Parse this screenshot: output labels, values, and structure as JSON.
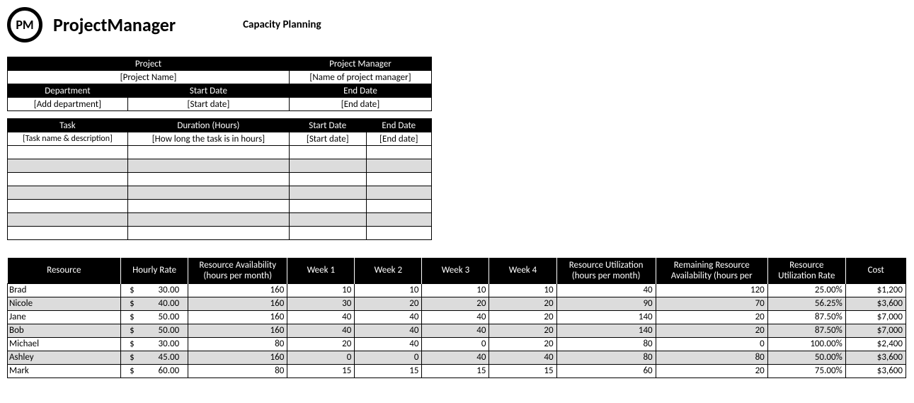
{
  "brand": "ProjectManager",
  "logo_abbrev": "PM",
  "page_title": "Capacity Planning",
  "info_headers": {
    "project": "Project",
    "project_manager": "Project Manager",
    "department": "Department",
    "start_date": "Start Date",
    "end_date": "End Date"
  },
  "info_values": {
    "project": "[Project Name]",
    "project_manager": "[Name of project manager]",
    "department": "[Add department]",
    "start_date": "[Start date]",
    "end_date": "[End date]"
  },
  "task_headers": {
    "task": "Task",
    "duration": "Duration (Hours)",
    "start": "Start Date",
    "end": "End Date"
  },
  "task_placeholders": {
    "task": "[Task name & description]",
    "duration": "[How long the task is in hours]",
    "start": "[Start date]",
    "end": "[End date]"
  },
  "resource_headers": {
    "resource": "Resource",
    "rate": "Hourly Rate",
    "avail": "Resource Availability (hours per month)",
    "w1": "Week 1",
    "w2": "Week 2",
    "w3": "Week 3",
    "w4": "Week 4",
    "util": "Resource Utilization (hours per month)",
    "remain": "Remaining Resource Availability (hours per",
    "util_rate": "Resource Utilization Rate",
    "cost": "Cost"
  },
  "resources": [
    {
      "name": "Brad",
      "rate": "30.00",
      "avail": "160",
      "w1": "10",
      "w2": "10",
      "w3": "10",
      "w4": "10",
      "util": "40",
      "remain": "120",
      "util_rate": "25.00%",
      "cost": "$1,200"
    },
    {
      "name": "Nicole",
      "rate": "40.00",
      "avail": "160",
      "w1": "30",
      "w2": "20",
      "w3": "20",
      "w4": "20",
      "util": "90",
      "remain": "70",
      "util_rate": "56.25%",
      "cost": "$3,600"
    },
    {
      "name": "Jane",
      "rate": "50.00",
      "avail": "160",
      "w1": "40",
      "w2": "40",
      "w3": "40",
      "w4": "20",
      "util": "140",
      "remain": "20",
      "util_rate": "87.50%",
      "cost": "$7,000"
    },
    {
      "name": "Bob",
      "rate": "50.00",
      "avail": "160",
      "w1": "40",
      "w2": "40",
      "w3": "40",
      "w4": "20",
      "util": "140",
      "remain": "20",
      "util_rate": "87.50%",
      "cost": "$7,000"
    },
    {
      "name": "Michael",
      "rate": "30.00",
      "avail": "80",
      "w1": "20",
      "w2": "40",
      "w3": "0",
      "w4": "20",
      "util": "80",
      "remain": "0",
      "util_rate": "100.00%",
      "cost": "$2,400"
    },
    {
      "name": "Ashley",
      "rate": "45.00",
      "avail": "160",
      "w1": "0",
      "w2": "0",
      "w3": "40",
      "w4": "40",
      "util": "80",
      "remain": "80",
      "util_rate": "50.00%",
      "cost": "$3,600"
    },
    {
      "name": "Mark",
      "rate": "60.00",
      "avail": "80",
      "w1": "15",
      "w2": "15",
      "w3": "15",
      "w4": "15",
      "util": "60",
      "remain": "20",
      "util_rate": "75.00%",
      "cost": "$3,600"
    }
  ]
}
